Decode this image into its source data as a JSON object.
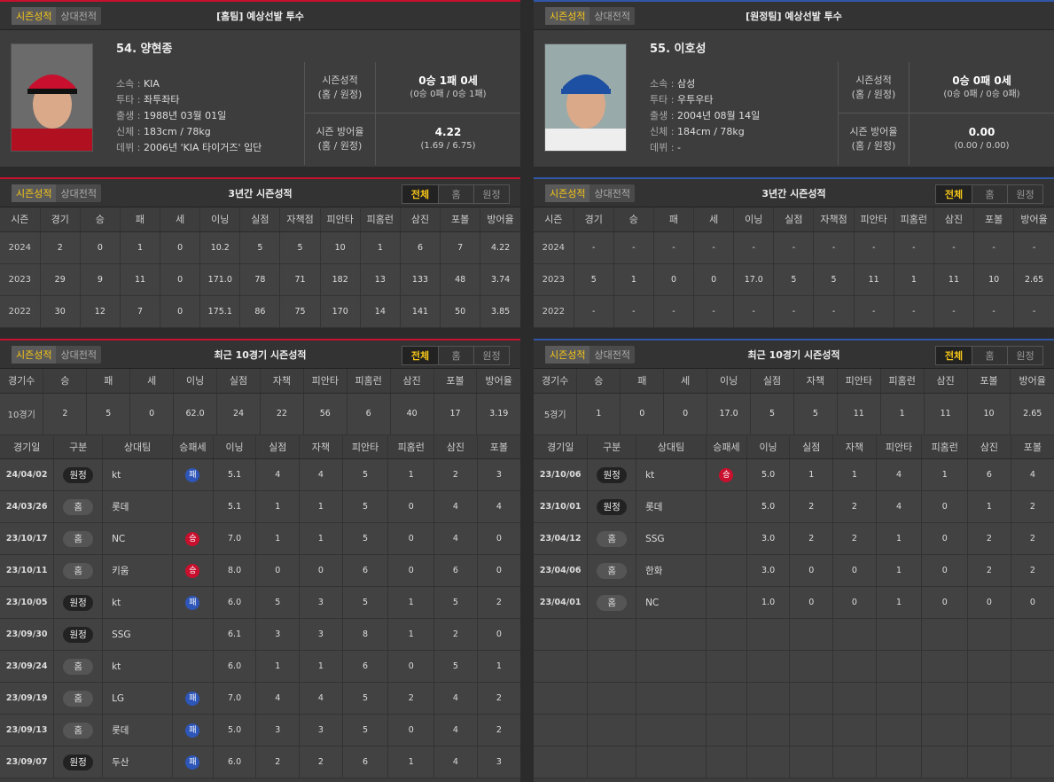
{
  "tabs": {
    "season": "시즌성적",
    "vs": "상대전적"
  },
  "filters": [
    "전체",
    "홈",
    "원정"
  ],
  "home": {
    "header": "[홈팀] 예상선발 투수",
    "name": "54. 양현종",
    "info": [
      [
        "소속",
        "KIA"
      ],
      [
        "투타",
        "좌투좌타"
      ],
      [
        "출생",
        "1988년 03월 01일"
      ],
      [
        "신체",
        "183cm / 78kg"
      ],
      [
        "데뷔",
        "2006년 'KIA 타이거즈' 입단"
      ]
    ],
    "record_label": "시즌성적\n(홈 / 원정)",
    "record": "0승 1패 0세",
    "record_split": "(0승 0패 / 0승 1패)",
    "era_label": "시즌 방어율\n(홈 / 원정)",
    "era": "4.22",
    "era_split": "(1.69 / 6.75)",
    "yearly_title": "3년간 시즌성적",
    "yearly": [
      [
        "2024",
        "2",
        "0",
        "1",
        "0",
        "10.2",
        "5",
        "5",
        "10",
        "1",
        "6",
        "7",
        "4.22"
      ],
      [
        "2023",
        "29",
        "9",
        "11",
        "0",
        "171.0",
        "78",
        "71",
        "182",
        "13",
        "133",
        "48",
        "3.74"
      ],
      [
        "2022",
        "30",
        "12",
        "7",
        "0",
        "175.1",
        "86",
        "75",
        "170",
        "14",
        "141",
        "50",
        "3.85"
      ]
    ],
    "recent_title": "최근 10경기 시즌성적",
    "recent_summary": [
      "10경기",
      "2",
      "5",
      "0",
      "62.0",
      "24",
      "22",
      "56",
      "6",
      "40",
      "17",
      "3.19"
    ],
    "games": [
      [
        "24/04/02",
        "원정",
        "kt",
        "L",
        "5.1",
        "4",
        "4",
        "5",
        "1",
        "2",
        "3"
      ],
      [
        "24/03/26",
        "홈",
        "롯데",
        "",
        "5.1",
        "1",
        "1",
        "5",
        "0",
        "4",
        "4"
      ],
      [
        "23/10/17",
        "홈",
        "NC",
        "W",
        "7.0",
        "1",
        "1",
        "5",
        "0",
        "4",
        "0"
      ],
      [
        "23/10/11",
        "홈",
        "키움",
        "W",
        "8.0",
        "0",
        "0",
        "6",
        "0",
        "6",
        "0"
      ],
      [
        "23/10/05",
        "원정",
        "kt",
        "L",
        "6.0",
        "5",
        "3",
        "5",
        "1",
        "5",
        "2"
      ],
      [
        "23/09/30",
        "원정",
        "SSG",
        "",
        "6.1",
        "3",
        "3",
        "8",
        "1",
        "2",
        "0"
      ],
      [
        "23/09/24",
        "홈",
        "kt",
        "",
        "6.0",
        "1",
        "1",
        "6",
        "0",
        "5",
        "1"
      ],
      [
        "23/09/19",
        "홈",
        "LG",
        "L",
        "7.0",
        "4",
        "4",
        "5",
        "2",
        "4",
        "2"
      ],
      [
        "23/09/13",
        "홈",
        "롯데",
        "L",
        "5.0",
        "3",
        "3",
        "5",
        "0",
        "4",
        "2"
      ],
      [
        "23/09/07",
        "원정",
        "두산",
        "L",
        "6.0",
        "2",
        "2",
        "6",
        "1",
        "4",
        "3"
      ]
    ]
  },
  "away": {
    "header": "[원정팀] 예상선발 투수",
    "name": "55. 이호성",
    "info": [
      [
        "소속",
        "삼성"
      ],
      [
        "투타",
        "우투우타"
      ],
      [
        "출생",
        "2004년 08월 14일"
      ],
      [
        "신체",
        "184cm / 78kg"
      ],
      [
        "데뷔",
        "-"
      ]
    ],
    "record_label": "시즌성적\n(홈 / 원정)",
    "record": "0승 0패 0세",
    "record_split": "(0승 0패 / 0승 0패)",
    "era_label": "시즌 방어율\n(홈 / 원정)",
    "era": "0.00",
    "era_split": "(0.00 / 0.00)",
    "yearly_title": "3년간 시즌성적",
    "yearly": [
      [
        "2024",
        "-",
        "-",
        "-",
        "-",
        "-",
        "-",
        "-",
        "-",
        "-",
        "-",
        "-",
        "-"
      ],
      [
        "2023",
        "5",
        "1",
        "0",
        "0",
        "17.0",
        "5",
        "5",
        "11",
        "1",
        "11",
        "10",
        "2.65"
      ],
      [
        "2022",
        "-",
        "-",
        "-",
        "-",
        "-",
        "-",
        "-",
        "-",
        "-",
        "-",
        "-",
        "-"
      ]
    ],
    "recent_title": "최근 10경기 시즌성적",
    "recent_summary": [
      "5경기",
      "1",
      "0",
      "0",
      "17.0",
      "5",
      "5",
      "11",
      "1",
      "11",
      "10",
      "2.65"
    ],
    "games": [
      [
        "23/10/06",
        "원정",
        "kt",
        "W",
        "5.0",
        "1",
        "1",
        "4",
        "1",
        "6",
        "4"
      ],
      [
        "23/10/01",
        "원정",
        "롯데",
        "",
        "5.0",
        "2",
        "2",
        "4",
        "0",
        "1",
        "2"
      ],
      [
        "23/04/12",
        "홈",
        "SSG",
        "",
        "3.0",
        "2",
        "2",
        "1",
        "0",
        "2",
        "2"
      ],
      [
        "23/04/06",
        "홈",
        "한화",
        "",
        "3.0",
        "0",
        "0",
        "1",
        "0",
        "2",
        "2"
      ],
      [
        "23/04/01",
        "홈",
        "NC",
        "",
        "1.0",
        "0",
        "0",
        "1",
        "0",
        "0",
        "0"
      ]
    ]
  },
  "yearly_cols": [
    "시즌",
    "경기",
    "승",
    "패",
    "세",
    "이닝",
    "실점",
    "자책점",
    "피안타",
    "피홈런",
    "삼진",
    "포볼",
    "방어율"
  ],
  "recent_cols": [
    "경기수",
    "승",
    "패",
    "세",
    "이닝",
    "실점",
    "자책",
    "피안타",
    "피홈런",
    "삼진",
    "포볼",
    "방어율"
  ],
  "game_cols": [
    "경기일",
    "구분",
    "상대팀",
    "승패세",
    "이닝",
    "실점",
    "자책",
    "피안타",
    "피홈런",
    "삼진",
    "포볼"
  ],
  "result_labels": {
    "W": "승",
    "L": "패"
  },
  "colors": {
    "home_accent": "#c8102e",
    "away_accent": "#3057a8",
    "win": "#c8102e",
    "loss": "#2e56b8",
    "highlight": "#f5c518"
  }
}
